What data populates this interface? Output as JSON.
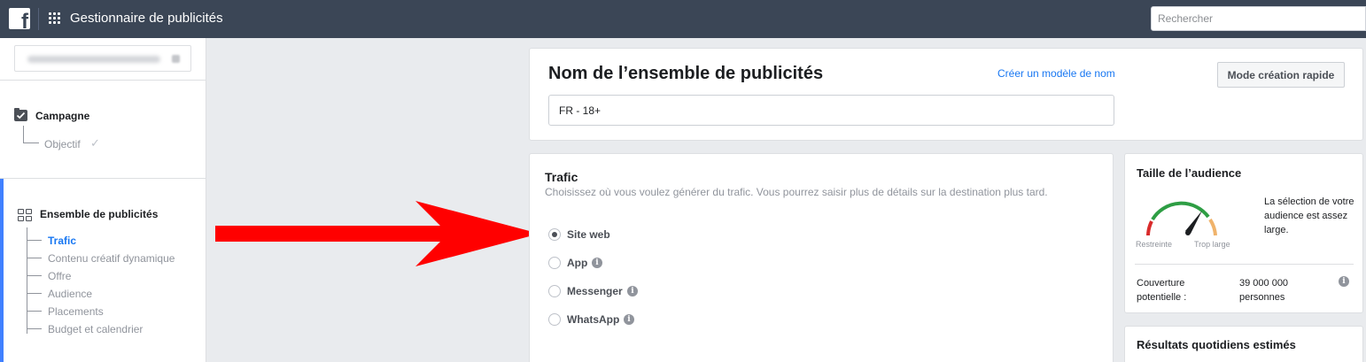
{
  "topbar": {
    "logo_letter": "f",
    "app_title": "Gestionnaire de publicités",
    "search_placeholder": "Rechercher"
  },
  "sidebar": {
    "campaign": {
      "label": "Campagne",
      "children": [
        {
          "label": "Objectif",
          "completed": true
        }
      ]
    },
    "ad_set": {
      "label": "Ensemble de publicités",
      "items": [
        {
          "label": "Trafic",
          "active": true
        },
        {
          "label": "Contenu créatif dynamique",
          "active": false
        },
        {
          "label": "Offre",
          "active": false
        },
        {
          "label": "Audience",
          "active": false
        },
        {
          "label": "Placements",
          "active": false
        },
        {
          "label": "Budget et calendrier",
          "active": false
        }
      ]
    }
  },
  "ad_set_name": {
    "title": "Nom de l’ensemble de publicités",
    "template_link": "Créer un modèle de nom",
    "quick_mode_button": "Mode création rapide",
    "value": "FR - 18+"
  },
  "traffic": {
    "title": "Trafic",
    "description": "Choisissez où vous voulez générer du trafic. Vous pourrez saisir plus de détails sur la destination plus tard.",
    "options": [
      {
        "label": "Site web",
        "selected": true,
        "info": false
      },
      {
        "label": "App",
        "selected": false,
        "info": true
      },
      {
        "label": "Messenger",
        "selected": false,
        "info": true
      },
      {
        "label": "WhatsApp",
        "selected": false,
        "info": true
      }
    ]
  },
  "audience": {
    "title": "Taille de l’audience",
    "gauge_left_label": "Restreinte",
    "gauge_right_label": "Trop large",
    "summary": "La sélection de votre audience est assez large.",
    "coverage_label": "Couverture potentielle :",
    "coverage_value": "39 000 000 personnes"
  },
  "estimated": {
    "title": "Résultats quotidiens estimés"
  },
  "colors": {
    "topbar": "#3b4656",
    "link": "#1877f2",
    "active_bar": "#4080ff",
    "arrow": "#ff0000",
    "gauge_green": "#2e9e44",
    "gauge_red": "#d92b2b",
    "gauge_orange": "#f0b36b"
  }
}
